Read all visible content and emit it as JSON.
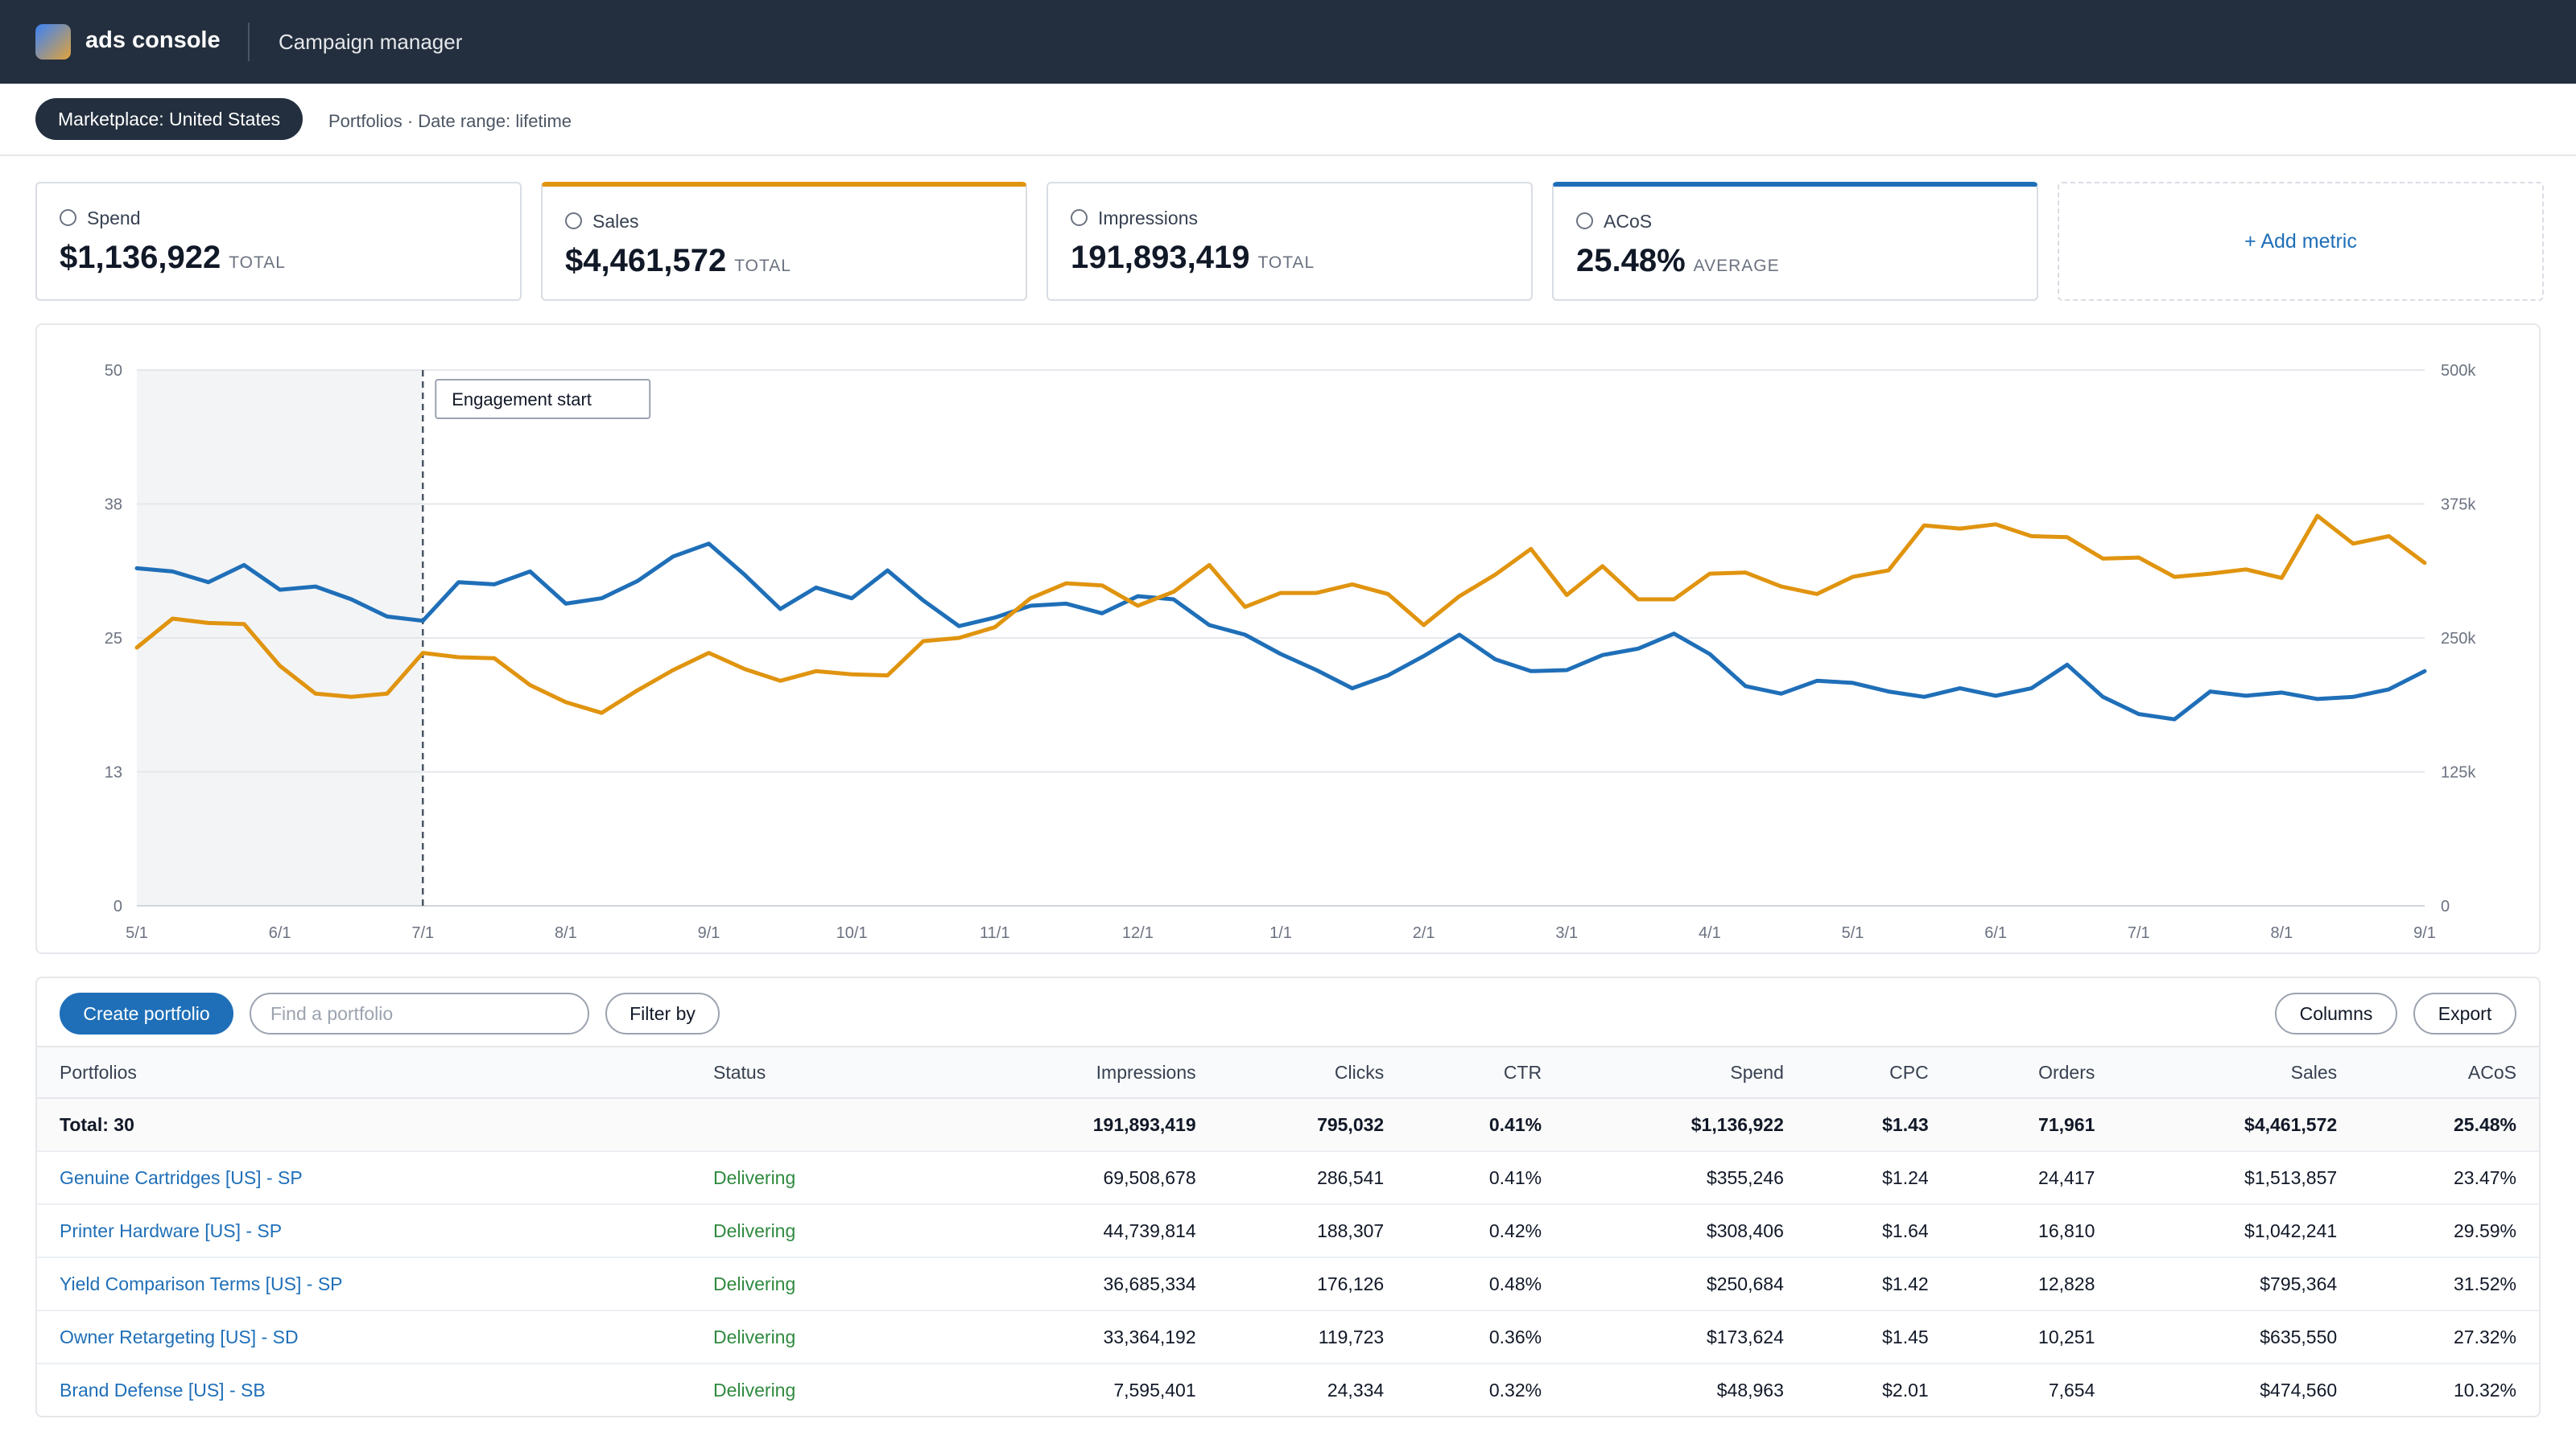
{
  "app": {
    "brand": "ads console",
    "title": "Campaign manager"
  },
  "filters": {
    "marketplace": "Marketplace: United States",
    "context": "Portfolios · Date range: lifetime"
  },
  "metrics": [
    {
      "label": "Spend",
      "value": "$1,136,922",
      "unit": "TOTAL"
    },
    {
      "label": "Sales",
      "value": "$4,461,572",
      "unit": "TOTAL"
    },
    {
      "label": "Impressions",
      "value": "191,893,419",
      "unit": "TOTAL"
    },
    {
      "label": "ACoS",
      "value": "25.48%",
      "unit": "AVERAGE"
    }
  ],
  "add_metric_label": "+ Add metric",
  "colors": {
    "sales": "#e0940f",
    "acos": "#1f6fb8",
    "brand_bar": "#232f3e"
  },
  "chart_data": {
    "type": "line",
    "annotation": {
      "label": "Engagement start",
      "x": "7/1"
    },
    "shaded_range": [
      "5/1",
      "7/1"
    ],
    "x_ticks": [
      "5/1",
      "6/1",
      "7/1",
      "8/1",
      "9/1",
      "10/1",
      "11/1",
      "12/1",
      "1/1",
      "2/1",
      "3/1",
      "4/1",
      "5/1",
      "6/1",
      "7/1",
      "8/1",
      "9/1"
    ],
    "y_left": {
      "ticks": [
        "0",
        "13",
        "25",
        "38",
        "50"
      ],
      "range": [
        0,
        50
      ]
    },
    "y_right": {
      "ticks": [
        "0",
        "125k",
        "250k",
        "375k",
        "500k"
      ],
      "range": [
        0,
        500000
      ]
    },
    "grid": true,
    "series": [
      {
        "axis": "left",
        "color": "#1f6fb8",
        "values": [
          31.5,
          31.2,
          30.2,
          31.8,
          29.5,
          29.8,
          28.6,
          27.0,
          26.6,
          30.2,
          30.0,
          31.2,
          28.2,
          28.7,
          30.3,
          32.6,
          33.8,
          30.9,
          27.7,
          29.7,
          28.7,
          31.3,
          28.5,
          26.1,
          26.9,
          28.0,
          28.2,
          27.3,
          28.9,
          28.6,
          26.2,
          25.3,
          23.5,
          22.0,
          20.3,
          21.5,
          23.3,
          25.3,
          23.0,
          21.9,
          22.0,
          23.4,
          24.0,
          25.4,
          23.5,
          20.5,
          19.8,
          21.0,
          20.8,
          20.0,
          19.5,
          20.3,
          19.6,
          20.3,
          22.5,
          19.5,
          17.9,
          17.4,
          20.0,
          19.6,
          19.9,
          19.3,
          19.5,
          20.2,
          21.9
        ]
      },
      {
        "axis": "right",
        "color": "#e0940f",
        "values": [
          241000,
          268000,
          264000,
          263000,
          224000,
          198000,
          195000,
          198000,
          236000,
          232000,
          231000,
          206000,
          190000,
          180000,
          201000,
          220000,
          236000,
          221000,
          210000,
          219000,
          216000,
          215000,
          247000,
          250000,
          260000,
          287000,
          301000,
          299000,
          280000,
          293000,
          318000,
          279000,
          292000,
          292000,
          300000,
          291000,
          262000,
          289000,
          309000,
          333000,
          290000,
          317000,
          286000,
          286000,
          310000,
          311000,
          298000,
          291000,
          307000,
          313000,
          355000,
          352000,
          356000,
          345000,
          344000,
          324000,
          325000,
          307000,
          310000,
          314000,
          306000,
          364000,
          338000,
          345000,
          320000
        ]
      }
    ]
  },
  "toolbar": {
    "create_label": "Create portfolio",
    "search_placeholder": "Find a portfolio",
    "filter_label": "Filter by",
    "columns_label": "Columns",
    "export_label": "Export"
  },
  "table": {
    "headers": [
      "Portfolios",
      "Status",
      "Impressions",
      "Clicks",
      "CTR",
      "Spend",
      "CPC",
      "Orders",
      "Sales",
      "ACoS"
    ],
    "total": [
      "Total: 30",
      "",
      "191,893,419",
      "795,032",
      "0.41%",
      "$1,136,922",
      "$1.43",
      "71,961",
      "$4,461,572",
      "25.48%"
    ],
    "rows": [
      [
        "Genuine Cartridges [US] - SP",
        "Delivering",
        "69,508,678",
        "286,541",
        "0.41%",
        "$355,246",
        "$1.24",
        "24,417",
        "$1,513,857",
        "23.47%"
      ],
      [
        "Printer Hardware [US] - SP",
        "Delivering",
        "44,739,814",
        "188,307",
        "0.42%",
        "$308,406",
        "$1.64",
        "16,810",
        "$1,042,241",
        "29.59%"
      ],
      [
        "Yield Comparison Terms [US] - SP",
        "Delivering",
        "36,685,334",
        "176,126",
        "0.48%",
        "$250,684",
        "$1.42",
        "12,828",
        "$795,364",
        "31.52%"
      ],
      [
        "Owner Retargeting [US] - SD",
        "Delivering",
        "33,364,192",
        "119,723",
        "0.36%",
        "$173,624",
        "$1.45",
        "10,251",
        "$635,550",
        "27.32%"
      ],
      [
        "Brand Defense [US] - SB",
        "Delivering",
        "7,595,401",
        "24,334",
        "0.32%",
        "$48,963",
        "$2.01",
        "7,654",
        "$474,560",
        "10.32%"
      ]
    ]
  }
}
